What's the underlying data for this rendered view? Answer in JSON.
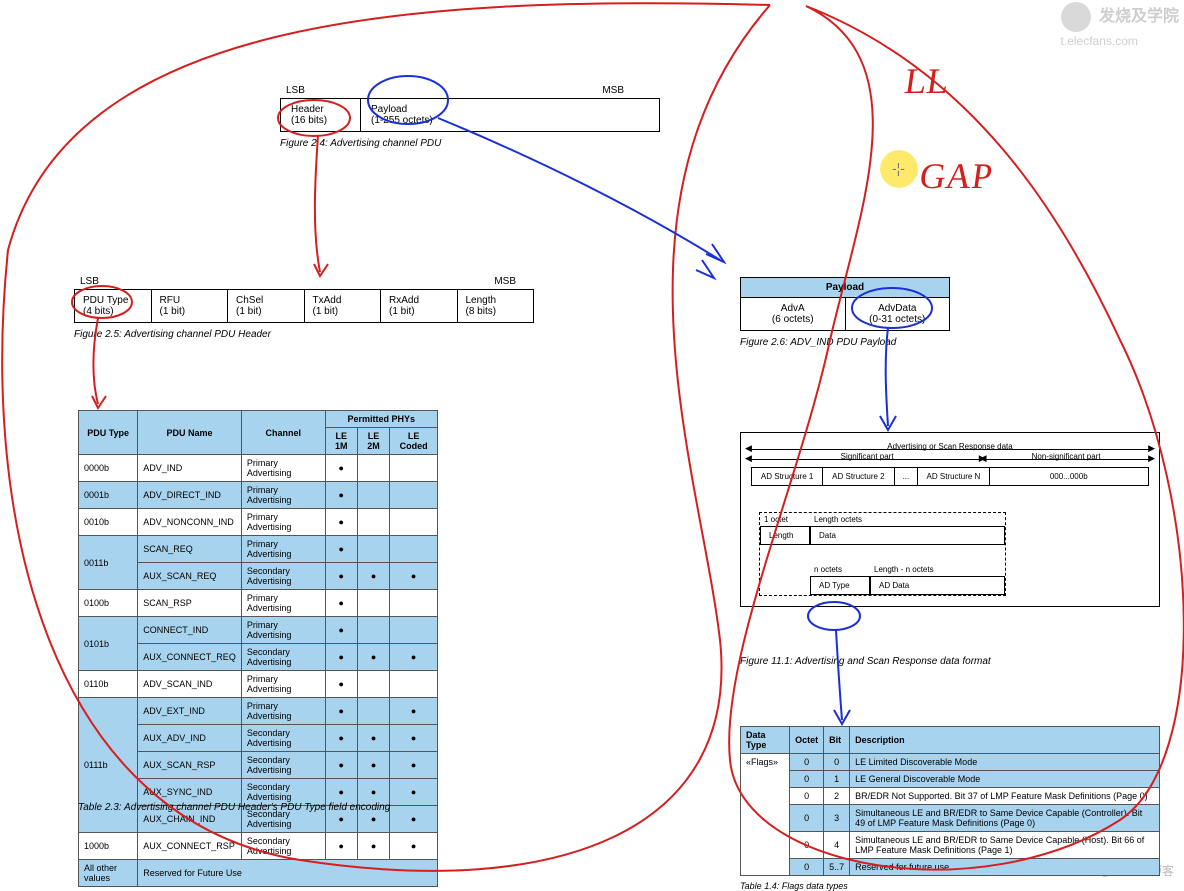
{
  "watermark": {
    "top_text": "发烧及学院",
    "top_url": "t.elecfans.com",
    "bottom": "@51CTO博客"
  },
  "handwriting": {
    "ll": "LL",
    "gap": "GAP",
    "cursor": "-¦-"
  },
  "fig24": {
    "lsb": "LSB",
    "msb": "MSB",
    "header": "Header",
    "header_sub": "(16 bits)",
    "payload": "Payload",
    "payload_sub": "(1-255 octets)",
    "caption": "Figure 2.4:  Advertising channel PDU"
  },
  "fig25": {
    "lsb": "LSB",
    "msb": "MSB",
    "fields": [
      {
        "name": "PDU Type",
        "sub": "(4 bits)"
      },
      {
        "name": "RFU",
        "sub": "(1 bit)"
      },
      {
        "name": "ChSel",
        "sub": "(1 bit)"
      },
      {
        "name": "TxAdd",
        "sub": "(1 bit)"
      },
      {
        "name": "RxAdd",
        "sub": "(1 bit)"
      },
      {
        "name": "Length",
        "sub": "(8 bits)"
      }
    ],
    "caption": "Figure 2.5:  Advertising channel PDU Header"
  },
  "fig26": {
    "title": "Payload",
    "adva": "AdvA",
    "adva_sub": "(6 octets)",
    "advdata": "AdvData",
    "advdata_sub": "(0-31 octets)",
    "caption": "Figure 2.6:  ADV_IND PDU Payload"
  },
  "tbl23": {
    "headers": {
      "pdu_type": "PDU Type",
      "pdu_name": "PDU Name",
      "channel": "Channel",
      "phys": "Permitted PHYs",
      "le1m": "LE 1M",
      "le2m": "LE 2M",
      "lecoded": "LE Coded"
    },
    "rows": [
      {
        "type": "0000b",
        "name": "ADV_IND",
        "ch": "Primary Advertising",
        "p": [
          1,
          0,
          0
        ],
        "blue": false,
        "rowspan": 1
      },
      {
        "type": "0001b",
        "name": "ADV_DIRECT_IND",
        "ch": "Primary Advertising",
        "p": [
          1,
          0,
          0
        ],
        "blue": true,
        "rowspan": 1
      },
      {
        "type": "0010b",
        "name": "ADV_NONCONN_IND",
        "ch": "Primary Advertising",
        "p": [
          1,
          0,
          0
        ],
        "blue": false,
        "rowspan": 1
      },
      {
        "type": "0011b",
        "name": "SCAN_REQ",
        "ch": "Primary Advertising",
        "p": [
          1,
          0,
          0
        ],
        "blue": true,
        "rowspan": 2
      },
      {
        "type": "",
        "name": "AUX_SCAN_REQ",
        "ch": "Secondary Advertising",
        "p": [
          1,
          1,
          1
        ],
        "blue": true,
        "rowspan": 0
      },
      {
        "type": "0100b",
        "name": "SCAN_RSP",
        "ch": "Primary Advertising",
        "p": [
          1,
          0,
          0
        ],
        "blue": false,
        "rowspan": 1
      },
      {
        "type": "0101b",
        "name": "CONNECT_IND",
        "ch": "Primary Advertising",
        "p": [
          1,
          0,
          0
        ],
        "blue": true,
        "rowspan": 2
      },
      {
        "type": "",
        "name": "AUX_CONNECT_REQ",
        "ch": "Secondary Advertising",
        "p": [
          1,
          1,
          1
        ],
        "blue": true,
        "rowspan": 0
      },
      {
        "type": "0110b",
        "name": "ADV_SCAN_IND",
        "ch": "Primary Advertising",
        "p": [
          1,
          0,
          0
        ],
        "blue": false,
        "rowspan": 1
      },
      {
        "type": "0111b",
        "name": "ADV_EXT_IND",
        "ch": "Primary Advertising",
        "p": [
          1,
          0,
          1
        ],
        "blue": true,
        "rowspan": 5
      },
      {
        "type": "",
        "name": "AUX_ADV_IND",
        "ch": "Secondary Advertising",
        "p": [
          1,
          1,
          1
        ],
        "blue": true,
        "rowspan": 0
      },
      {
        "type": "",
        "name": "AUX_SCAN_RSP",
        "ch": "Secondary Advertising",
        "p": [
          1,
          1,
          1
        ],
        "blue": true,
        "rowspan": 0
      },
      {
        "type": "",
        "name": "AUX_SYNC_IND",
        "ch": "Secondary Advertising",
        "p": [
          1,
          1,
          1
        ],
        "blue": true,
        "rowspan": 0
      },
      {
        "type": "",
        "name": "AUX_CHAIN_IND",
        "ch": "Secondary Advertising",
        "p": [
          1,
          1,
          1
        ],
        "blue": true,
        "rowspan": 0
      },
      {
        "type": "1000b",
        "name": "AUX_CONNECT_RSP",
        "ch": "Secondary Advertising",
        "p": [
          1,
          1,
          1
        ],
        "blue": false,
        "rowspan": 1
      },
      {
        "type": "All other values",
        "name": "Reserved for Future Use",
        "ch": "",
        "p": [
          0,
          0,
          0
        ],
        "blue": true,
        "rowspan": 1,
        "colspan": 6
      }
    ],
    "caption": "Table 2.3:  Advertising channel PDU Header's PDU Type field encoding"
  },
  "fig111": {
    "top": "Advertising or Scan Response data",
    "sig": "Significant part",
    "nonsig": "Non-significant part",
    "cells": [
      "AD Structure 1",
      "AD Structure 2",
      "...",
      "AD Structure N",
      "000...000b"
    ],
    "row1_a": "1 octet",
    "row1_b": "Length octets",
    "row2_a": "Length",
    "row2_b": "Data",
    "row3_a": "n octets",
    "row3_b": "Length - n octets",
    "row4_a": "AD Type",
    "row4_b": "AD Data",
    "caption": "Figure 11.1:  Advertising and Scan Response data format"
  },
  "tbl14": {
    "headers": {
      "dt": "Data Type",
      "octet": "Octet",
      "bit": "Bit",
      "desc": "Description"
    },
    "dt": "«Flags»",
    "rows": [
      {
        "o": "0",
        "b": "0",
        "d": "LE Limited Discoverable Mode",
        "blue": true
      },
      {
        "o": "0",
        "b": "1",
        "d": "LE General Discoverable Mode",
        "blue": true
      },
      {
        "o": "0",
        "b": "2",
        "d": "BR/EDR Not Supported. Bit 37 of LMP Feature Mask Definitions (Page 0)",
        "blue": false
      },
      {
        "o": "0",
        "b": "3",
        "d": "Simultaneous LE and BR/EDR to Same Device Capable (Controller). Bit 49 of LMP Feature Mask Definitions (Page 0)",
        "blue": true
      },
      {
        "o": "0",
        "b": "4",
        "d": "Simultaneous LE and BR/EDR to Same Device Capable (Host). Bit 66 of LMP Feature Mask Definitions (Page 1)",
        "blue": false
      },
      {
        "o": "0",
        "b": "5..7",
        "d": "Reserved for future use",
        "blue": true
      }
    ],
    "caption": "Table 1.4:  Flags data types"
  }
}
